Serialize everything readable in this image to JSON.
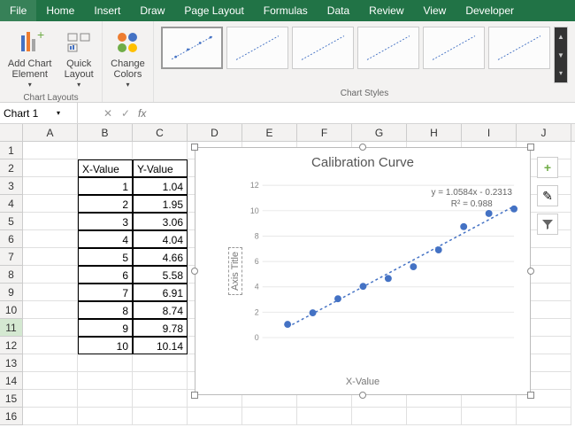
{
  "ribbon": {
    "tabs": [
      "File",
      "Home",
      "Insert",
      "Draw",
      "Page Layout",
      "Formulas",
      "Data",
      "Review",
      "View",
      "Developer"
    ],
    "group1_label": "Chart Layouts",
    "group2_label": "Chart Styles",
    "add_chart_element": "Add Chart\nElement",
    "quick_layout": "Quick\nLayout",
    "change_colors": "Change\nColors"
  },
  "formula_bar": {
    "name_box": "Chart 1",
    "fx": "fx"
  },
  "columns": [
    "A",
    "B",
    "C",
    "D",
    "E",
    "F",
    "G",
    "H",
    "I",
    "J"
  ],
  "row_numbers": [
    1,
    2,
    3,
    4,
    5,
    6,
    7,
    8,
    9,
    10,
    11,
    12,
    13,
    14,
    15,
    16
  ],
  "selected_row": 11,
  "table": {
    "headers": [
      "X-Value",
      "Y-Value"
    ],
    "header_row": 2,
    "col_start": "B",
    "rows": [
      [
        1,
        1.04
      ],
      [
        2,
        1.95
      ],
      [
        3,
        3.06
      ],
      [
        4,
        4.04
      ],
      [
        5,
        4.66
      ],
      [
        6,
        5.58
      ],
      [
        7,
        6.91
      ],
      [
        8,
        8.74
      ],
      [
        9,
        9.78
      ],
      [
        10,
        10.14
      ]
    ]
  },
  "chart_data": {
    "type": "scatter",
    "title": "Calibration Curve",
    "xlabel": "X-Value",
    "ylabel": "Axis Title",
    "series": [
      {
        "name": "Y-Value",
        "x": [
          1,
          2,
          3,
          4,
          5,
          6,
          7,
          8,
          9,
          10
        ],
        "y": [
          1.04,
          1.95,
          3.06,
          4.04,
          4.66,
          5.58,
          6.91,
          8.74,
          9.78,
          10.14
        ]
      }
    ],
    "trendline": {
      "equation": "y = 1.0584x - 0.2313",
      "r2": "R² = 0.988"
    },
    "xlim": [
      0,
      10
    ],
    "ylim": [
      0,
      12
    ],
    "yticks": [
      0,
      2,
      4,
      6,
      8,
      10,
      12
    ]
  },
  "chart_side": {
    "plus": "+",
    "brush": "✎",
    "filter": "▾"
  }
}
